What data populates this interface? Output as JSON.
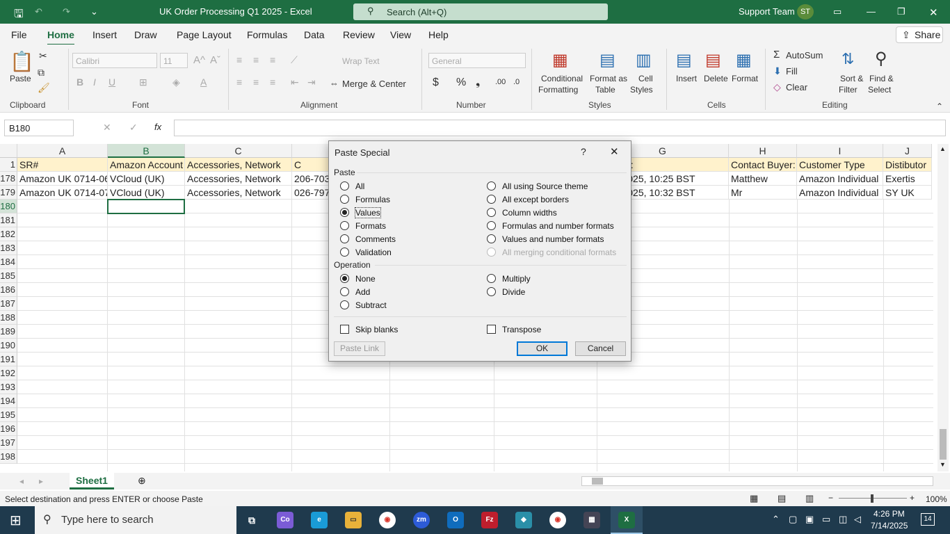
{
  "titlebar": {
    "doc_title": "UK Order Processing Q1 2025 - Excel",
    "search": "Search (Alt+Q)",
    "user": "Support Team",
    "initials": "ST"
  },
  "tabs": [
    "File",
    "Home",
    "Insert",
    "Draw",
    "Page Layout",
    "Formulas",
    "Data",
    "Review",
    "View",
    "Help"
  ],
  "share": "Share",
  "ribbon": {
    "paste": "Paste",
    "font_name": "Calibri",
    "font_size": "11",
    "wrap": "Wrap Text",
    "merge": "Merge & Center",
    "number_format": "General",
    "cond_fmt": [
      "Conditional",
      "Formatting"
    ],
    "fmt_table": [
      "Format as",
      "Table"
    ],
    "cell_styles": [
      "Cell",
      "Styles"
    ],
    "insert": "Insert",
    "delete": "Delete",
    "format": "Format",
    "autosum": "AutoSum",
    "fill": "Fill",
    "clear": "Clear",
    "sort": [
      "Sort &",
      "Filter"
    ],
    "find": [
      "Find &",
      "Select"
    ],
    "groups": [
      "Clipboard",
      "Font",
      "Alignment",
      "Number",
      "Styles",
      "Cells",
      "Editing"
    ]
  },
  "formula_bar": {
    "name_box": "B180",
    "fx": "fx"
  },
  "columns": [
    "A",
    "B",
    "C",
    "G",
    "H",
    "I",
    "J"
  ],
  "header_row": {
    "num": "1",
    "A": "SR#",
    "B": "Amazon Account",
    "C": "Accessories, Network",
    "D": "C",
    "G": "se date:",
    "H": "Contact Buyer:",
    "I": "Customer Type",
    "J": "Distibutor"
  },
  "rows": [
    {
      "num": "178",
      "A": "Amazon UK 0714-06",
      "B": "VCloud (UK)",
      "C": "Accessories, Network",
      "D": "206-703",
      "G": "4 Jul 2025, 10:25 BST",
      "H": "Matthew",
      "I": "Amazon Individual",
      "J": "Exertis"
    },
    {
      "num": "179",
      "A": "Amazon UK 0714-07",
      "B": "VCloud (UK)",
      "C": "Accessories, Network",
      "D": "026-797",
      "G": "4 Jul 2025, 10:32 BST",
      "H": "Mr",
      "I": "Amazon Individual",
      "J": "SY UK"
    }
  ],
  "empty_rows": [
    "180",
    "181",
    "182",
    "183",
    "184",
    "185",
    "186",
    "187",
    "188",
    "189",
    "190",
    "191",
    "192",
    "193",
    "194",
    "195",
    "196",
    "197",
    "198"
  ],
  "dialog": {
    "title": "Paste Special",
    "help": "?",
    "close": "✕",
    "paste_label": "Paste",
    "paste_left": [
      {
        "label": "All",
        "on": false
      },
      {
        "label": "Formulas",
        "on": false
      },
      {
        "label": "Values",
        "on": true
      },
      {
        "label": "Formats",
        "on": false
      },
      {
        "label": "Comments",
        "on": false
      },
      {
        "label": "Validation",
        "on": false
      }
    ],
    "paste_right": [
      {
        "label": "All using Source theme",
        "on": false
      },
      {
        "label": "All except borders",
        "on": false
      },
      {
        "label": "Column widths",
        "on": false
      },
      {
        "label": "Formulas and number formats",
        "on": false
      },
      {
        "label": "Values and number formats",
        "on": false
      },
      {
        "label": "All merging conditional formats",
        "on": false,
        "disabled": true
      }
    ],
    "operation_label": "Operation",
    "op_left": [
      {
        "label": "None",
        "on": true
      },
      {
        "label": "Add",
        "on": false
      },
      {
        "label": "Subtract",
        "on": false
      }
    ],
    "op_right": [
      {
        "label": "Multiply",
        "on": false
      },
      {
        "label": "Divide",
        "on": false
      }
    ],
    "skip_blanks": "Skip blanks",
    "transpose": "Transpose",
    "paste_link": "Paste Link",
    "ok": "OK",
    "cancel": "Cancel"
  },
  "sheet_tab": "Sheet1",
  "status": {
    "message": "Select destination and press ENTER or choose Paste",
    "zoom": "100%"
  },
  "taskbar": {
    "search": "Type here to search",
    "time": "4:26 PM",
    "date": "7/14/2025",
    "notif": "14"
  }
}
